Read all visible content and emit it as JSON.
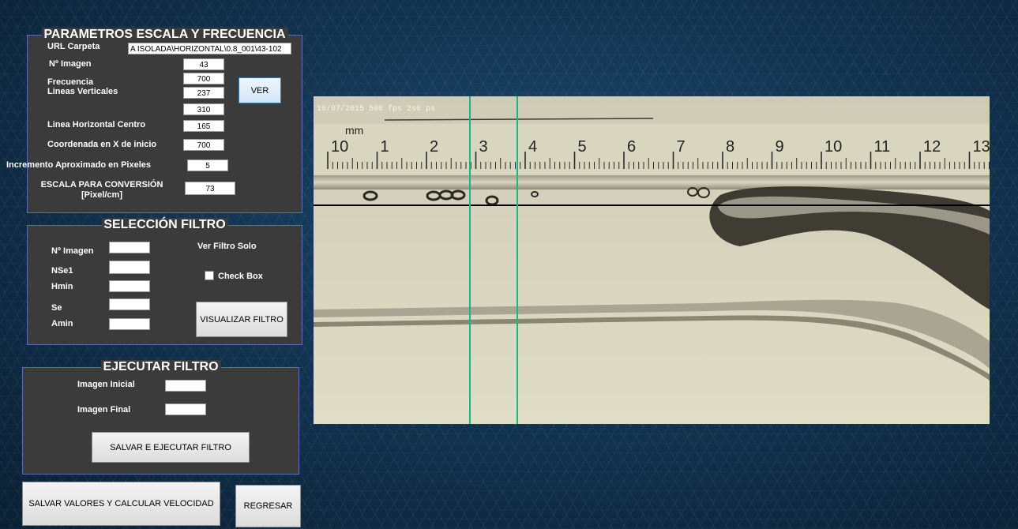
{
  "params": {
    "title": "PARAMETROS ESCALA Y FRECUENCIA",
    "url_label": "URL Carpeta",
    "url_value": "A ISOLADA\\HORIZONTAL\\0.8_001\\43-102",
    "n_imagen_label": "Nº Imagen",
    "n_imagen_value": "43",
    "frecuencia_label": "Frecuencia",
    "frecuencia_value": "700",
    "lineas_verticales_label": "Lineas Verticales",
    "linea_v1_value": "237",
    "linea_v2_value": "310",
    "ver_button": "VER",
    "linea_horizontal_label": "Linea Horizontal Centro",
    "linea_horizontal_value": "165",
    "coord_x_label": "Coordenada en X de inicio",
    "coord_x_value": "700",
    "incremento_label": "Incremento Aproximado en Pixeles",
    "incremento_value": "5",
    "escala_label_line1": "ESCALA PARA CONVERSIÓN",
    "escala_label_line2": "[Pixel/cm]",
    "escala_value": "73"
  },
  "filtro": {
    "title": "SELECCIÓN FILTRO",
    "n_imagen_label": "Nº Imagen",
    "nse1_label": "NSe1",
    "hmin_label": "Hmin",
    "se_label": "Se",
    "amin_label": "Amin",
    "n_imagen_value": "",
    "nse1_value": "",
    "hmin_value": "",
    "se_value": "",
    "amin_value": "",
    "ver_filtro_solo_label": "Ver Filtro Solo",
    "checkbox_label": "Check Box",
    "visualizar_button": "VISUALIZAR  FILTRO"
  },
  "ejecutar": {
    "title": "EJECUTAR FILTRO",
    "imagen_inicial_label": "Imagen Inicial",
    "imagen_final_label": "Imagen Final",
    "imagen_inicial_value": "",
    "imagen_final_value": "",
    "salvar_ejecutar_button": "SALVAR E EJECUTAR  FILTRO"
  },
  "bottom": {
    "salvar_calcular_button": "SALVAR VALORES  Y CALCULAR VELOCIDAD",
    "regresar_button": "REGRESAR"
  },
  "image": {
    "timestamp": "10/07/2015 500 fps 2s0 ps",
    "unit_label": "mm",
    "ruler_numbers": [
      "10",
      "1",
      "2",
      "3",
      "4",
      "5",
      "6",
      "7",
      "8",
      "9",
      "10",
      "11",
      "12",
      "13"
    ]
  },
  "colors": {
    "panel_bg": "#3b3b3b",
    "panel_border": "#5a6fb8",
    "guide_line": "#1fb487"
  }
}
